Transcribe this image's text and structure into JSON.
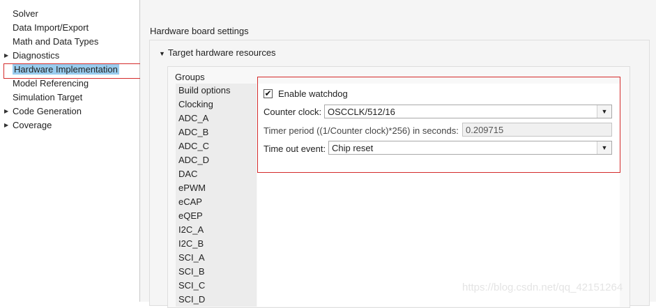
{
  "tree": {
    "items": [
      {
        "label": "Solver",
        "expandable": false
      },
      {
        "label": "Data Import/Export",
        "expandable": false
      },
      {
        "label": "Math and Data Types",
        "expandable": false
      },
      {
        "label": "Diagnostics",
        "expandable": true
      },
      {
        "label": "Hardware Implementation",
        "expandable": false,
        "selected": true
      },
      {
        "label": "Model Referencing",
        "expandable": false
      },
      {
        "label": "Simulation Target",
        "expandable": false
      },
      {
        "label": "Code Generation",
        "expandable": true
      },
      {
        "label": "Coverage",
        "expandable": true
      }
    ],
    "expand_icon": "▶"
  },
  "main": {
    "title": "Hardware board settings",
    "section_title": "Target hardware resources",
    "section_icon": "▼",
    "groups_label": "Groups",
    "groups": [
      "Build options",
      "Clocking",
      "ADC_A",
      "ADC_B",
      "ADC_C",
      "ADC_D",
      "DAC",
      "ePWM",
      "eCAP",
      "eQEP",
      "I2C_A",
      "I2C_B",
      "SCI_A",
      "SCI_B",
      "SCI_C",
      "SCI_D"
    ],
    "watchdog": {
      "enable_label": "Enable watchdog",
      "enabled": true,
      "check_glyph": "✔",
      "counter_clock_label": "Counter clock:",
      "counter_clock_value": "OSCCLK/512/16",
      "timer_period_label": "Timer period ((1/Counter clock)*256) in seconds:",
      "timer_period_value": "0.209715",
      "timeout_event_label": "Time out event:",
      "timeout_event_value": "Chip reset",
      "dropdown_glyph": "▼"
    }
  },
  "watermark": "https://blog.csdn.net/qq_42151264",
  "colors": {
    "selection": "#99ccee",
    "highlight_border": "#d42a2a"
  }
}
